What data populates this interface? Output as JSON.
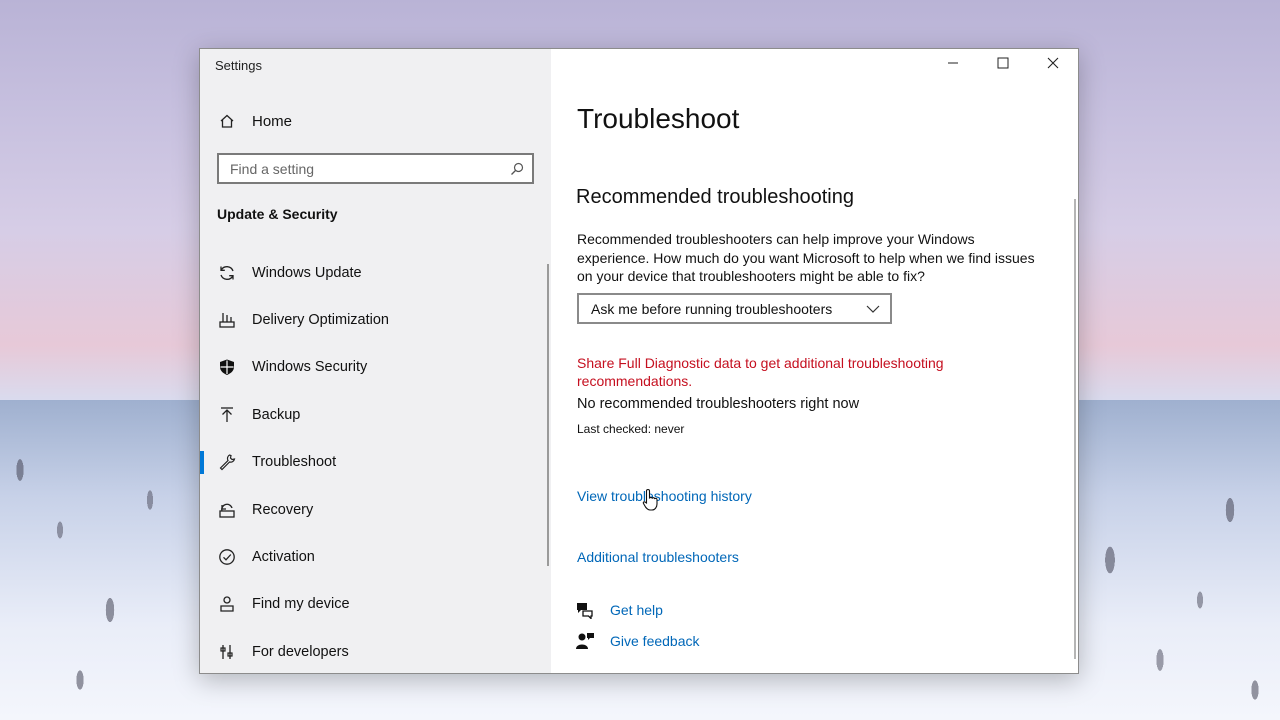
{
  "window": {
    "title": "Settings",
    "caption_buttons": [
      "minimize-icon",
      "maximize-icon",
      "close-icon"
    ]
  },
  "sidebar": {
    "home_label": "Home",
    "search_placeholder": "Find a setting",
    "section_title": "Update & Security",
    "items": [
      {
        "label": "Windows Update",
        "icon": "refresh-icon"
      },
      {
        "label": "Delivery Optimization",
        "icon": "delivery-optimization-icon"
      },
      {
        "label": "Windows Security",
        "icon": "shield-icon"
      },
      {
        "label": "Backup",
        "icon": "backup-arrow-icon"
      },
      {
        "label": "Troubleshoot",
        "icon": "wrench-icon",
        "active": true
      },
      {
        "label": "Recovery",
        "icon": "recovery-icon"
      },
      {
        "label": "Activation",
        "icon": "check-circle-icon"
      },
      {
        "label": "Find my device",
        "icon": "person-location-icon"
      },
      {
        "label": "For developers",
        "icon": "developer-tools-icon"
      }
    ]
  },
  "main": {
    "title": "Troubleshoot",
    "recommended_title": "Recommended troubleshooting",
    "description": "Recommended troubleshooters can help improve your Windows experience. How much do you want Microsoft to help when we find issues on your device that troubleshooters might be able to fix?",
    "dropdown_value": "Ask me before running troubleshooters",
    "warning_text": "Share Full Diagnostic data to get additional troubleshooting recommendations.",
    "status_text": "No recommended troubleshooters right now",
    "last_checked": "Last checked: never",
    "history_link": "View troubleshooting history",
    "additional_link": "Additional troubleshooters",
    "get_help": "Get help",
    "give_feedback": "Give feedback"
  },
  "colors": {
    "accent": "#0078d7",
    "link": "#0067b8",
    "warning": "#c50f1f",
    "sidebar_bg": "#f0f0f2"
  }
}
